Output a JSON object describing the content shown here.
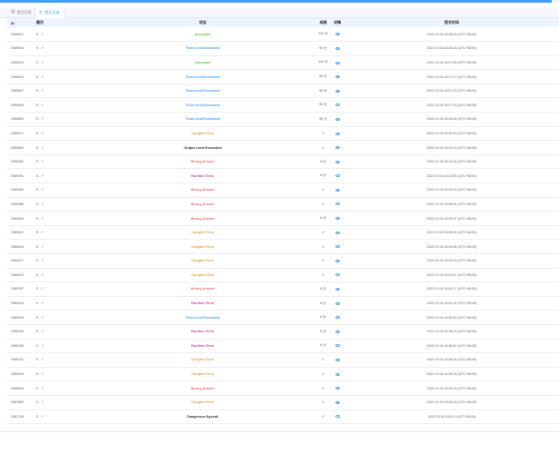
{
  "colors": {
    "accent": "#409eff"
  },
  "tabs": [
    {
      "label": "题目列表",
      "icon": "document-icon"
    },
    {
      "label": "提交记录",
      "icon": "refresh-icon"
    }
  ],
  "columns": {
    "id": "ID",
    "title": "题目",
    "status": "状态",
    "score": "成绩",
    "detail": "详情",
    "time": "提交时间"
  },
  "status_colors": {
    "Accepted": "#67c23a",
    "Time Limit Exceeded": "#409eff",
    "Compile Error": "#e6a23c",
    "Output Limit Exceeded": "#303133",
    "Wrong Answer": "#f56c6c",
    "Runtime Error": "#d946a8",
    "Dangerous Syscall": "#303133"
  },
  "rows": [
    {
      "id": "2989621",
      "title": "E - ?",
      "status": "Accepted",
      "score": "100 分",
      "time": "2023 10 04 16:28:53 (UTC+08:00)"
    },
    {
      "id": "2989616",
      "title": "E - ?",
      "status": "Time Limit Exceeded",
      "score": "96 分",
      "time": "2023 10 04 16:28:13 (UTC+08:00)"
    },
    {
      "id": "2989614",
      "title": "E - ?",
      "status": "Accepted",
      "score": "100 分",
      "time": "2023 10 04 16:27:49 (UTC+08:00)"
    },
    {
      "id": "2989613",
      "title": "E - ?",
      "status": "Time Limit Exceeded",
      "score": "96 分",
      "time": "2023 10 04 15:27:12 (UTC+08:00)"
    },
    {
      "id": "2989607",
      "title": "E - ?",
      "status": "Time Limit Exceeded",
      "score": "96 分",
      "time": "2023 10 04 15:27:13 (UTC+08:00)"
    },
    {
      "id": "2989606",
      "title": "E - ?",
      "status": "Time Limit Exceeded",
      "score": "96 分",
      "time": "2023 10 04 15:27:03 (UTC+08:00)"
    },
    {
      "id": "2989600",
      "title": "E - ?",
      "status": "Time Limit Exceeded",
      "score": "96 分",
      "time": "2023 10 04 15:26:50 (UTC+08:00)"
    },
    {
      "id": "2989572",
      "title": "E - ?",
      "status": "Compile Error",
      "score": "0",
      "time": "2023 10 04 15:20:43 (UTC+08:00)"
    },
    {
      "id": "2989560",
      "title": "E - ?",
      "status": "Output Limit Exceeded",
      "score": "0",
      "time": "2023 10 04 15:19:13 (UTC+08:00)"
    },
    {
      "id": "2989492",
      "title": "E - ?",
      "status": "Wrong Answer",
      "score": "8 分",
      "time": "2023 10 04 15:12:04 (UTC+08:00)"
    },
    {
      "id": "2989491",
      "title": "E - ?",
      "status": "Runtime Error",
      "score": "8 分",
      "time": "2023 10 04 15:10:53 (UTC+08:00)"
    },
    {
      "id": "2989480",
      "title": "E - ?",
      "status": "Wrong Answer",
      "score": "0",
      "time": "2023 10 04 15:09:13 (UTC+08:00)"
    },
    {
      "id": "2989466",
      "title": "E - ?",
      "status": "Wrong Answer",
      "score": "0",
      "time": "2023 10 04 15:08:54 (UTC+08:00)"
    },
    {
      "id": "2989454",
      "title": "E - ?",
      "status": "Wrong Answer",
      "score": "8 分",
      "time": "2023 10 04 15:05:27 (UTC+08:00)"
    },
    {
      "id": "2989451",
      "title": "E - ?",
      "status": "Compile Error",
      "score": "0",
      "time": "2023 10 04 15:05:04 (UTC+08:00)"
    },
    {
      "id": "2989444",
      "title": "E - ?",
      "status": "Compile Error",
      "score": "0",
      "time": "2023 10 04 15:04:35 (UTC+08:00)"
    },
    {
      "id": "2989427",
      "title": "E - ?",
      "status": "Compile Error",
      "score": "0",
      "time": "2023 10 04 15:02:13 (UTC+08:00)"
    },
    {
      "id": "2989423",
      "title": "E - ?",
      "status": "Compile Error",
      "score": "0",
      "time": "2023 10 04 15:01:47 (UTC+08:00)"
    },
    {
      "id": "2989257",
      "title": "E - ?",
      "status": "Wrong Answer",
      "score": "8 分",
      "time": "2023 10 04 14:44:17 (UTC+08:00)"
    },
    {
      "id": "2989216",
      "title": "E - ?",
      "status": "Runtime Error",
      "score": "8 分",
      "time": "2023 10 04 14:41:14 (UTC+08:00)"
    },
    {
      "id": "2989209",
      "title": "E - ?",
      "status": "Time Limit Exceeded",
      "score": "8 分",
      "time": "2023 10 04 14:40:23 (UTC+08:00)"
    },
    {
      "id": "2989190",
      "title": "E - ?",
      "status": "Runtime Error",
      "score": "8 分",
      "time": "2023 10 04 14:38:23 (UTC+08:00)"
    },
    {
      "id": "2989165",
      "title": "E - ?",
      "status": "Runtime Error",
      "score": "8 分",
      "time": "2023 10 04 14:36:42 (UTC+08:00)"
    },
    {
      "id": "2989151",
      "title": "E - ?",
      "status": "Compile Error",
      "score": "0",
      "time": "2023 10 04 14:35:26 (UTC+08:00)"
    },
    {
      "id": "2989144",
      "title": "E - ?",
      "status": "Compile Error",
      "score": "0",
      "time": "2023 10 04 14:34:23 (UTC+08:00)"
    },
    {
      "id": "2989006",
      "title": "E - ?",
      "status": "Wrong Answer",
      "score": "0",
      "time": "2023 10 04 14:23:23 (UTC+08:00)"
    },
    {
      "id": "2987582",
      "title": "E - ?",
      "status": "Compile Error",
      "score": "0",
      "time": "2023 10 04 10:43:33 (UTC+08:00)"
    },
    {
      "id": "2987106",
      "title": "E - ?",
      "status": "Dangerous Syscall",
      "score": "0",
      "time": "2023 10 04 9:26:11 (UTC+08:00)"
    }
  ]
}
